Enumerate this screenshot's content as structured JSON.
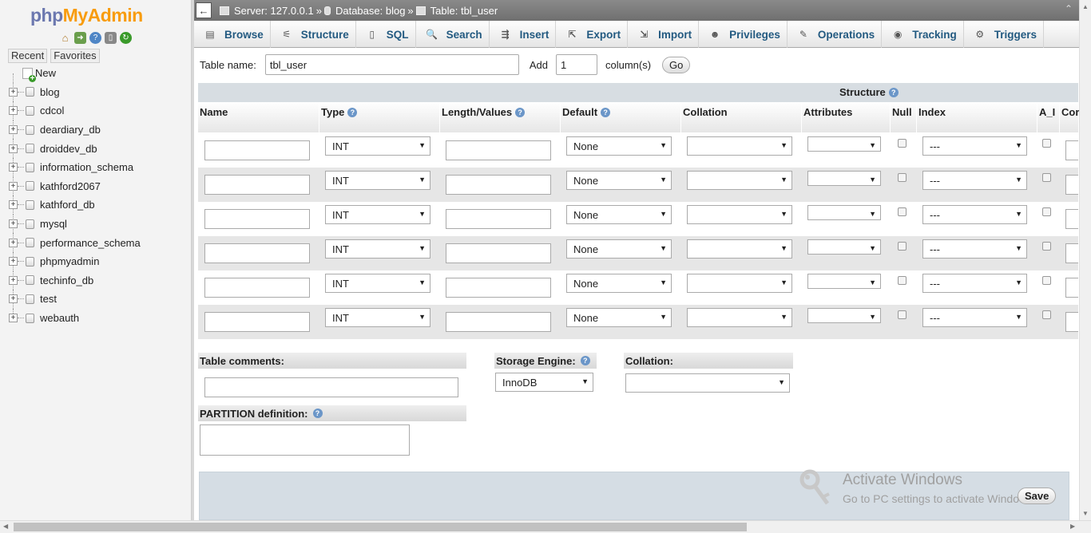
{
  "nav": {
    "logo_php": "php",
    "logo_admin": "MyAdmin",
    "recent_label": "Recent",
    "favorites_label": "Favorites",
    "new_label": "New",
    "databases": [
      "blog",
      "cdcol",
      "deardiary_db",
      "droiddev_db",
      "information_schema",
      "kathford2067",
      "kathford_db",
      "mysql",
      "performance_schema",
      "phpmyadmin",
      "techinfo_db",
      "test",
      "webauth"
    ]
  },
  "breadcrumb": {
    "server": "Server: 127.0.0.1",
    "sep": "»",
    "database": "Database: blog",
    "table": "Table: tbl_user"
  },
  "tabs": [
    {
      "label": "Browse",
      "icon": "browse-icon",
      "glyph": "▤"
    },
    {
      "label": "Structure",
      "icon": "structure-icon",
      "glyph": "⚟"
    },
    {
      "label": "SQL",
      "icon": "sql-icon",
      "glyph": "▯"
    },
    {
      "label": "Search",
      "icon": "search-icon",
      "glyph": "🔍"
    },
    {
      "label": "Insert",
      "icon": "insert-icon",
      "glyph": "⇶"
    },
    {
      "label": "Export",
      "icon": "export-icon",
      "glyph": "⇱"
    },
    {
      "label": "Import",
      "icon": "import-icon",
      "glyph": "⇲"
    },
    {
      "label": "Privileges",
      "icon": "privileges-icon",
      "glyph": "☻"
    },
    {
      "label": "Operations",
      "icon": "operations-icon",
      "glyph": "✎"
    },
    {
      "label": "Tracking",
      "icon": "tracking-icon",
      "glyph": "◉"
    },
    {
      "label": "Triggers",
      "icon": "triggers-icon",
      "glyph": "⚙"
    }
  ],
  "form": {
    "table_name_label": "Table name:",
    "table_name_value": "tbl_user",
    "add_label": "Add",
    "add_value": "1",
    "columns_label": "column(s)",
    "go_label": "Go"
  },
  "structure": {
    "title": "Structure",
    "columns": [
      "Name",
      "Type",
      "Length/Values",
      "Default",
      "Collation",
      "Attributes",
      "Null",
      "Index",
      "A_I",
      "Cor"
    ],
    "rows": [
      {
        "type": "INT",
        "default": "None",
        "index": "---"
      },
      {
        "type": "INT",
        "default": "None",
        "index": "---"
      },
      {
        "type": "INT",
        "default": "None",
        "index": "---"
      },
      {
        "type": "INT",
        "default": "None",
        "index": "---"
      },
      {
        "type": "INT",
        "default": "None",
        "index": "---"
      },
      {
        "type": "INT",
        "default": "None",
        "index": "---"
      }
    ]
  },
  "bottom": {
    "table_comments_label": "Table comments:",
    "storage_engine_label": "Storage Engine:",
    "storage_engine_value": "InnoDB",
    "collation_label": "Collation:",
    "partition_label": "PARTITION definition:",
    "save_label": "Save"
  },
  "watermark": {
    "line1": "Activate Windows",
    "line2": "Go to PC settings to activate Windows."
  },
  "colors": {
    "tab_text": "#235a81",
    "logo_php": "#6c78af",
    "logo_admin": "#f89c0e"
  }
}
